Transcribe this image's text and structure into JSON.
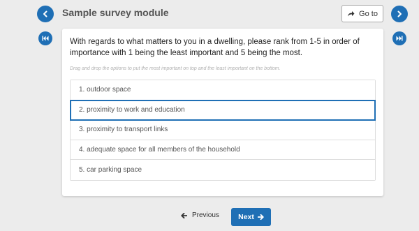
{
  "header": {
    "title": "Sample survey module",
    "goto_label": "Go to"
  },
  "question": {
    "text": "With regards to what matters to you in a dwelling, please rank from 1-5 in order of importance with 1 being the least important and 5 being the most.",
    "instruction": "Drag and drop the options to put the most important on top and the least important on the bottom.",
    "options": [
      {
        "label": "1. outdoor space"
      },
      {
        "label": "2. proximity to work and education"
      },
      {
        "label": "3. proximity to transport links"
      },
      {
        "label": "4. adequate space for all members of the household"
      },
      {
        "label": "5. car parking space"
      }
    ]
  },
  "footer": {
    "previous_label": "Previous",
    "next_label": "Next"
  },
  "colors": {
    "accent": "#1f6fb5",
    "background": "#ececec"
  },
  "icons": {
    "prev_module": "chevron-left-icon",
    "next_module": "chevron-right-icon",
    "first_page": "skip-first-icon",
    "last_page": "skip-last-icon",
    "goto": "share-arrow-icon",
    "previous": "arrow-left-icon",
    "next": "arrow-right-icon"
  }
}
